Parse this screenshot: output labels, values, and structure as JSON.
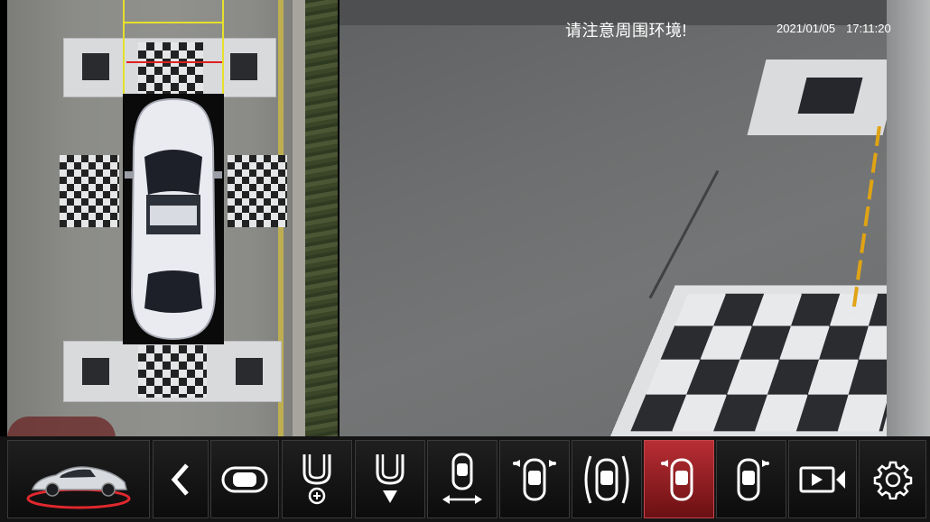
{
  "overlay": {
    "warning_text": "请注意周围环境!",
    "date": "2021/01/05",
    "time": "17:11:20"
  },
  "toolbar": {
    "buttons": [
      {
        "id": "car-model",
        "icon": "car-model-icon",
        "active": false
      },
      {
        "id": "back",
        "icon": "chevron-left-icon",
        "active": false
      },
      {
        "id": "top-view",
        "icon": "car-topview-icon",
        "active": false
      },
      {
        "id": "zoom-view",
        "icon": "zoom-in-view-icon",
        "active": false
      },
      {
        "id": "rear-down-view",
        "icon": "rear-down-arrow-icon",
        "active": false
      },
      {
        "id": "side-width-view",
        "icon": "car-width-arrow-icon",
        "active": false
      },
      {
        "id": "front-corners-view",
        "icon": "car-front-corners-icon",
        "active": false
      },
      {
        "id": "both-sides-view",
        "icon": "car-both-sides-icon",
        "active": false
      },
      {
        "id": "left-front-view",
        "icon": "car-left-front-icon",
        "active": true
      },
      {
        "id": "right-front-view",
        "icon": "car-right-front-icon",
        "active": false
      },
      {
        "id": "record",
        "icon": "video-record-icon",
        "active": false
      },
      {
        "id": "settings",
        "icon": "gear-icon",
        "active": false
      }
    ],
    "active_color": "#b82e34"
  }
}
